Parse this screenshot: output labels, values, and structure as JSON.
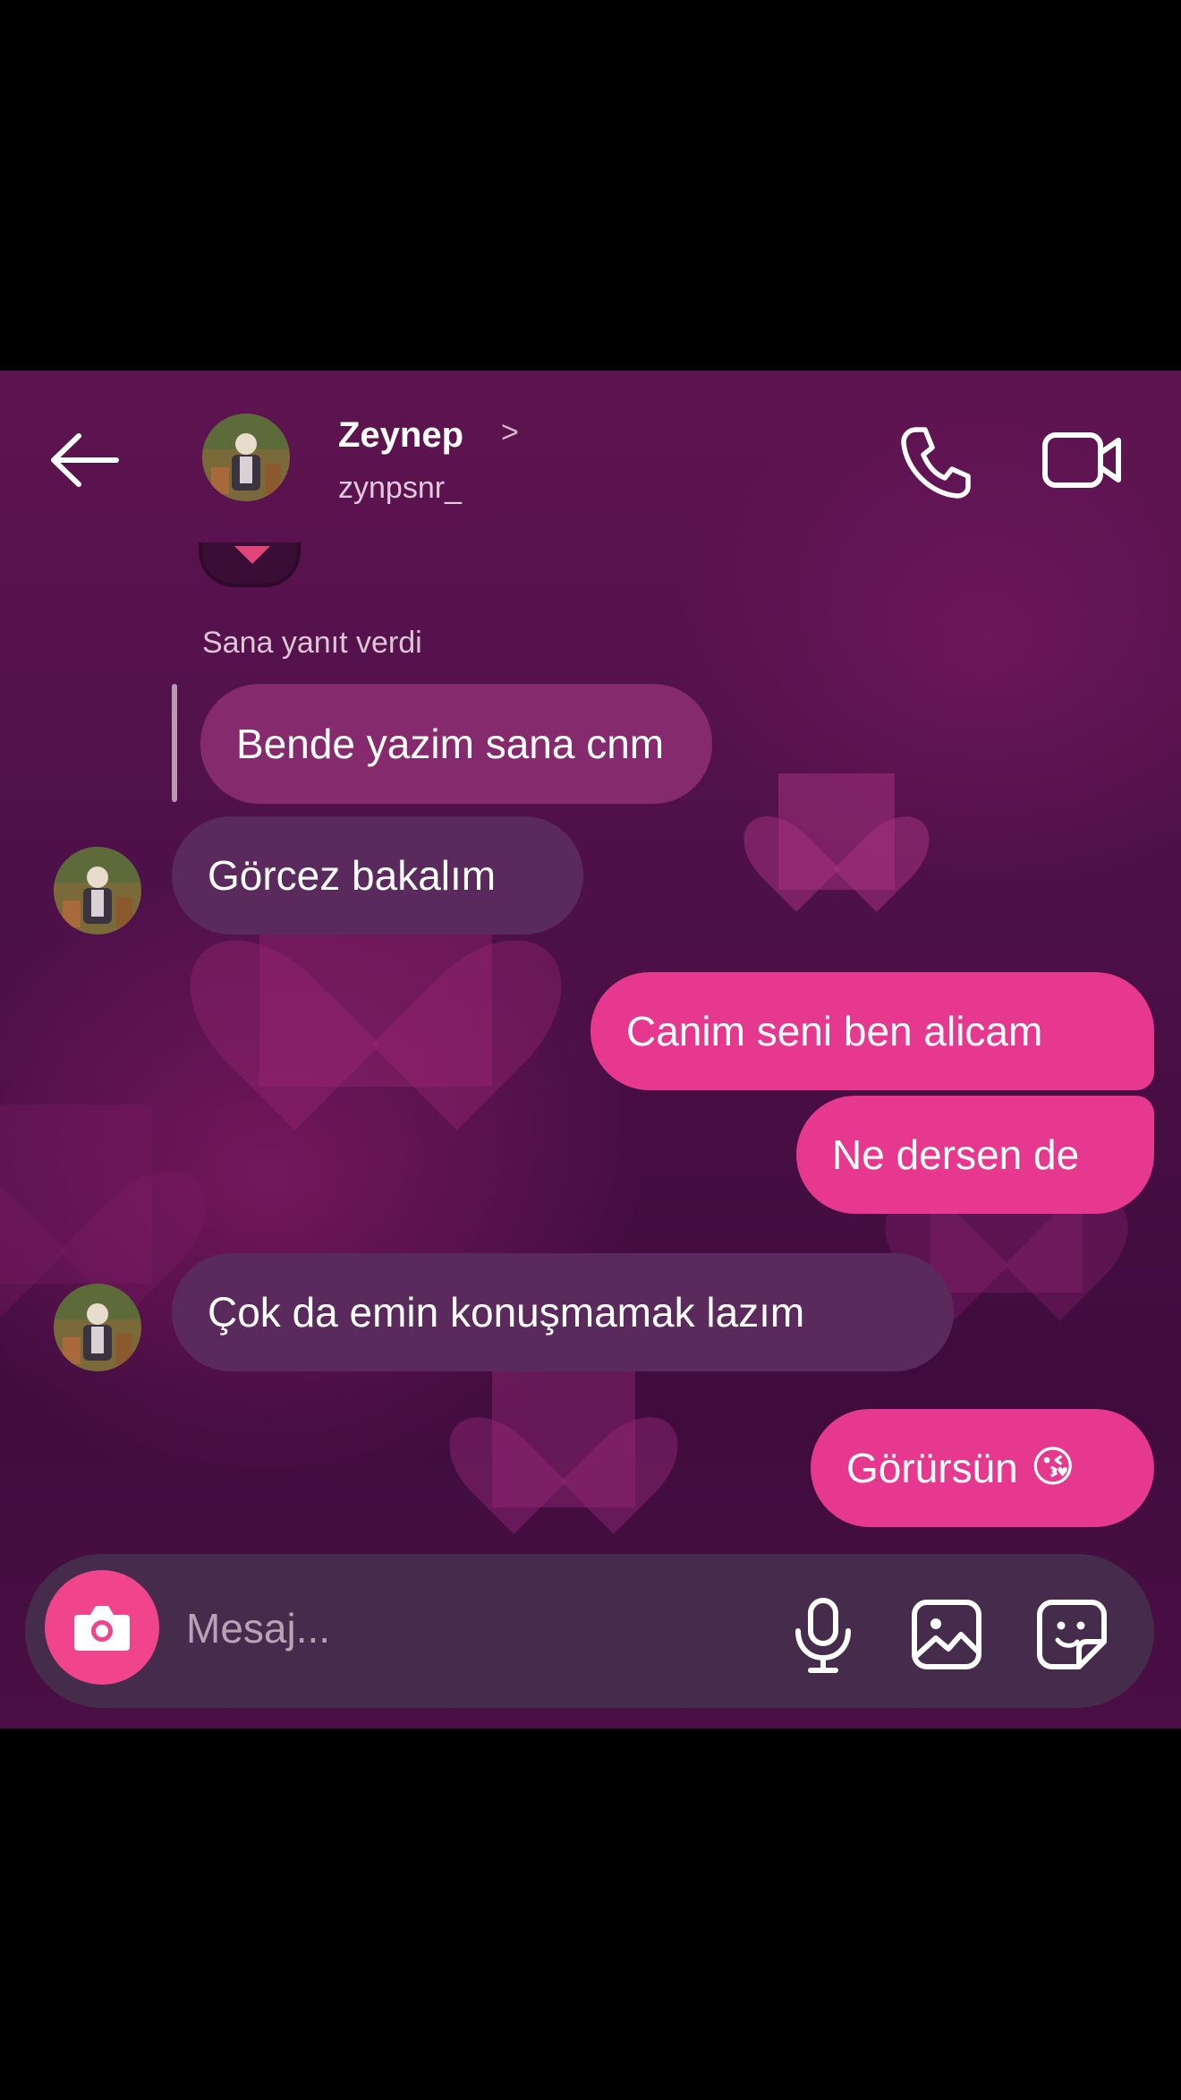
{
  "header": {
    "name": "Zeynep",
    "chevron": ">",
    "username": "zynpsnr_"
  },
  "reply": {
    "label": "Sana yanıt verdi",
    "quoted_text": "Bende yazim sana cnm"
  },
  "messages": [
    {
      "side": "incoming",
      "text": "Görcez bakalım"
    },
    {
      "side": "outgoing",
      "text": "Canim seni ben alicam"
    },
    {
      "side": "outgoing",
      "text": "Ne dersen de"
    },
    {
      "side": "incoming",
      "text": "Çok da emin konuşmamak lazım"
    },
    {
      "side": "outgoing",
      "text": "Görürsün",
      "emoji": "😘"
    }
  ],
  "composer": {
    "placeholder": "Mesaj..."
  },
  "icons": {
    "back": "back-arrow-icon",
    "call": "phone-icon",
    "video": "video-camera-icon",
    "camera": "camera-icon",
    "mic": "microphone-icon",
    "gallery": "gallery-icon",
    "sticker": "sticker-icon"
  },
  "colors": {
    "outgoing_bubble": "#e6388f",
    "incoming_bubble": "#5b2a5d",
    "quoted_bubble": "#862a6e",
    "camera_button": "#f0448c"
  }
}
